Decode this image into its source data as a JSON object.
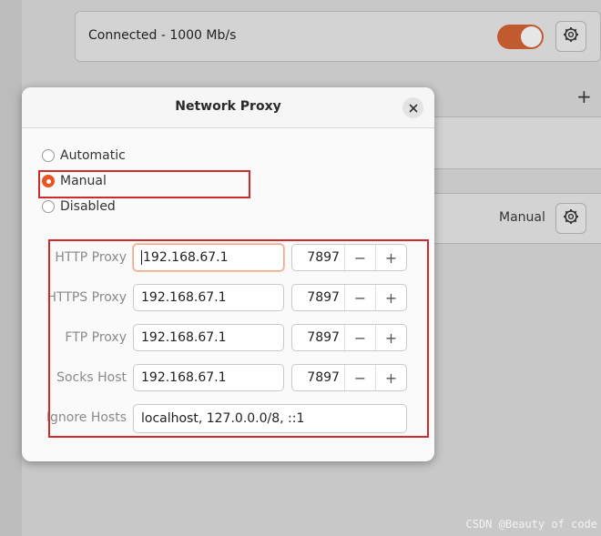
{
  "background": {
    "connection_status": "Connected - 1000 Mb/s",
    "add_symbol": "+",
    "proxy_mode_value": "Manual",
    "watermark": "CSDN @Beauty of code"
  },
  "dialog": {
    "title": "Network Proxy",
    "close_symbol": "×",
    "modes": [
      {
        "label": "Automatic",
        "checked": false
      },
      {
        "label": "Manual",
        "checked": true
      },
      {
        "label": "Disabled",
        "checked": false
      }
    ],
    "proxies": [
      {
        "label": "HTTP Proxy",
        "host": "192.168.67.1",
        "port": "7897"
      },
      {
        "label": "HTTPS Proxy",
        "host": "192.168.67.1",
        "port": "7897"
      },
      {
        "label": "FTP Proxy",
        "host": "192.168.67.1",
        "port": "7897"
      },
      {
        "label": "Socks Host",
        "host": "192.168.67.1",
        "port": "7897"
      }
    ],
    "ignore_hosts": {
      "label": "Ignore Hosts",
      "value": "localhost, 127.0.0.0/8, ::1"
    },
    "decrement_symbol": "−",
    "increment_symbol": "+"
  },
  "colors": {
    "accent": "#e95420",
    "annotation_box": "#d12a2a",
    "toggle_on": "#c25a30"
  },
  "icons": {
    "gear": "gear-icon",
    "close": "close-icon"
  }
}
